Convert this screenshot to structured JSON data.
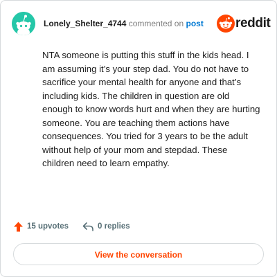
{
  "header": {
    "username": "Lonely_Shelter_4744",
    "action_text": "commented on",
    "post_link": "post",
    "brand": "reddit"
  },
  "comment": {
    "body": "NTA someone is putting this stuff in the kids head. I am assuming it’s your step dad. You do not have to sacrifice your mental health for anyone and that’s including kids. The children in question are old enough to know words hurt and when they are hurting someone. You are teaching them actions have consequences. You tried for 3 years to be the adult without help of your mom and stepdad. These children need to learn empathy."
  },
  "actions": {
    "upvotes_label": "15 upvotes",
    "replies_label": "0 replies"
  },
  "cta": {
    "label": "View the conversation"
  },
  "colors": {
    "avatar_bg": "#25c7a8",
    "brand_orange": "#ff4500",
    "link_blue": "#0079d3",
    "muted_text": "#576f76"
  },
  "icons": {
    "avatar": "snoo-avatar-icon",
    "brand": "reddit-logo-icon",
    "upvote": "upvote-arrow-icon",
    "reply": "reply-arrow-icon"
  }
}
